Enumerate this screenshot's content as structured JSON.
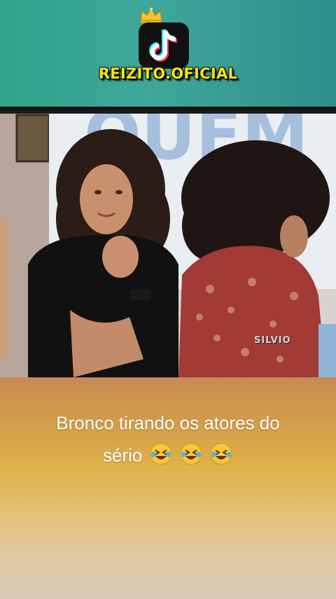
{
  "header": {
    "brand_name": "REIZITO.OFICIAL",
    "icons": [
      "crown-icon",
      "tiktok-logo-icon"
    ],
    "colors": {
      "band": "#2fa38c",
      "brand_text": "#f7e21b"
    }
  },
  "video": {
    "watermark": "SILVIO",
    "sign_text": "QUEM"
  },
  "caption": {
    "line1": "Bronco tirando os atores do",
    "line2": "sério",
    "emoji": [
      "rolling-on-floor-laughing-emoji",
      "rolling-on-floor-laughing-emoji",
      "rolling-on-floor-laughing-emoji"
    ]
  }
}
